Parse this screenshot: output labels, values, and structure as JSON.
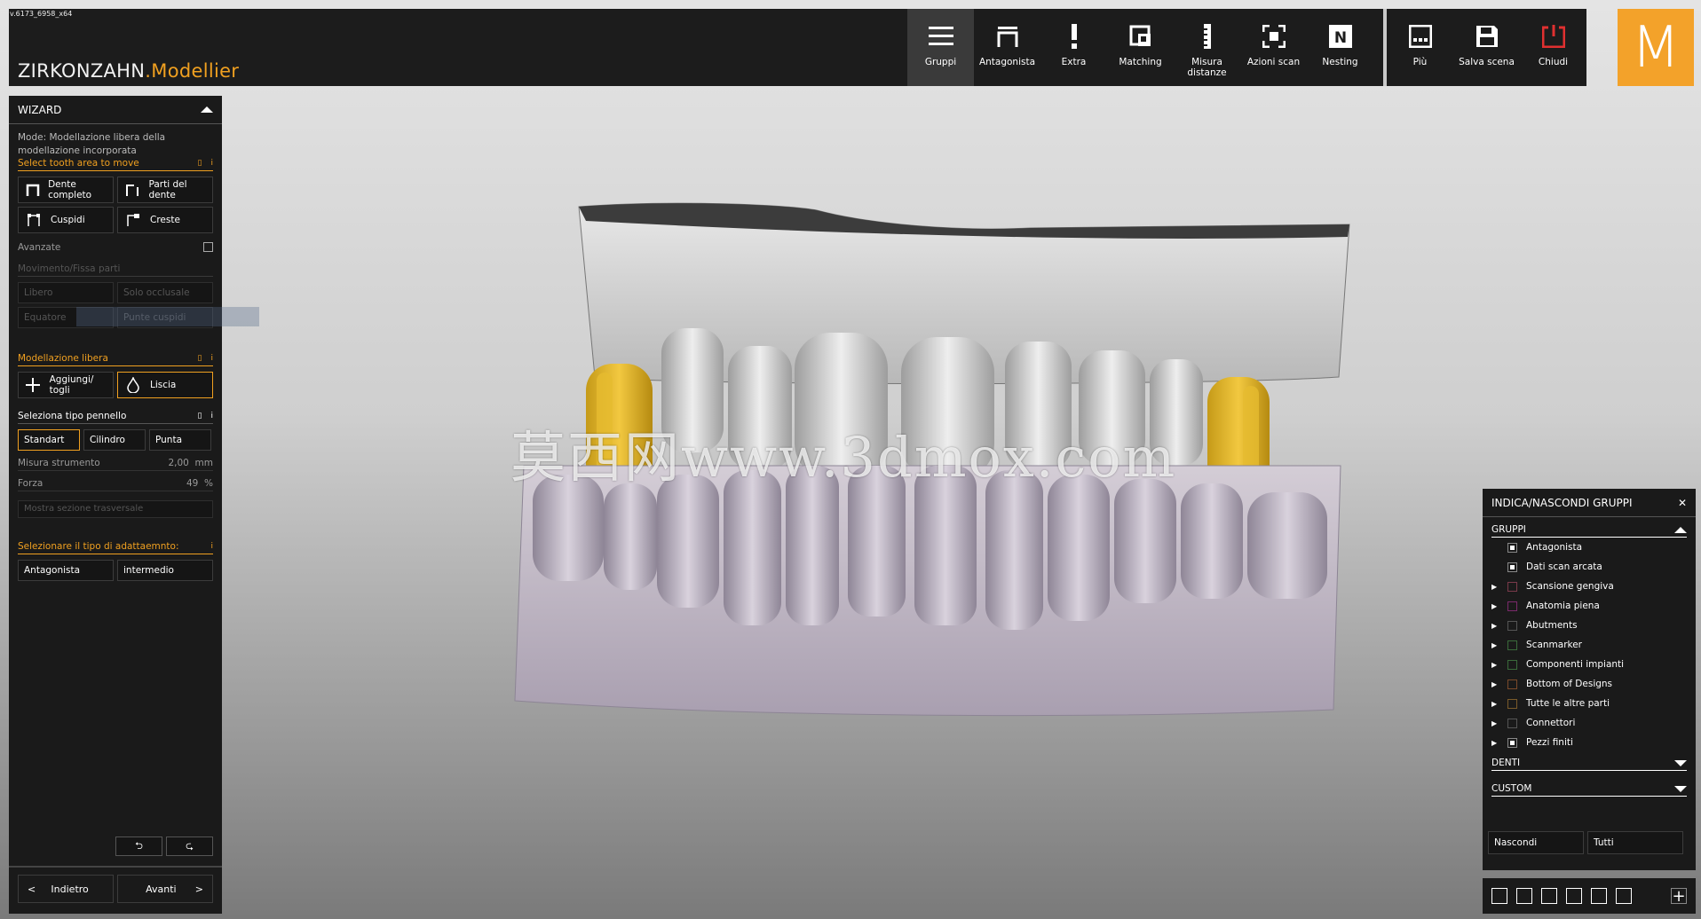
{
  "version": "v.6173_6958_x64",
  "brand": {
    "name": "ZIRKONZAHN",
    "sub": ".Modellier"
  },
  "toolbar": {
    "tools": [
      {
        "label": "Gruppi",
        "icon": "menu-icon"
      },
      {
        "label": "Antagonista",
        "icon": "antagonist-icon"
      },
      {
        "label": "Extra",
        "icon": "exclamation-icon"
      },
      {
        "label": "Matching",
        "icon": "matching-icon"
      },
      {
        "label": "Misura distanze",
        "icon": "ruler-icon"
      },
      {
        "label": "Azioni scan",
        "icon": "scan-icon"
      },
      {
        "label": "Nesting",
        "icon": "nesting-icon"
      }
    ],
    "right_tools": [
      {
        "label": "Più",
        "icon": "more-icon"
      },
      {
        "label": "Salva scena",
        "icon": "save-icon"
      },
      {
        "label": "Chiudi",
        "icon": "power-icon"
      }
    ],
    "logo_letter": "M"
  },
  "wizard": {
    "title": "WIZARD",
    "mode": "Mode: Modellazione libera della modellazione incorporata",
    "select_area_title": "Select tooth area to move",
    "area_buttons": [
      "Dente completo",
      "Parti del dente",
      "Cuspidi",
      "Creste"
    ],
    "advanced_label": "Avanzate",
    "movement_label": "Movimento/Fissa parti",
    "movement_buttons": [
      "Libero",
      "Solo occlusale",
      "Equatore",
      "Punte cuspidi"
    ],
    "free_modeling_title": "Modellazione libera",
    "free_buttons": [
      "Aggiungi/ togli",
      "Liscia"
    ],
    "brush_title": "Seleziona tipo pennello",
    "brush_buttons": [
      "Standart",
      "Cilindro",
      "Punta"
    ],
    "tool_size_label": "Misura strumento",
    "tool_size_value": "2,00",
    "tool_size_unit": "mm",
    "force_label": "Forza",
    "force_value": "49",
    "force_unit": "%",
    "cross_section_label": "Mostra sezione trasversale",
    "adapt_title": "Selezionare il tipo di adattaemnto:",
    "adapt_buttons": [
      "Antagonista",
      "intermedio"
    ],
    "back_label": "Indietro",
    "next_label": "Avanti"
  },
  "groups_panel": {
    "title": "INDICA/NASCONDI GRUPPI",
    "groups_label": "GRUPPI",
    "items": [
      {
        "label": "Antagonista",
        "arrow": false,
        "checked": true,
        "color": "#888888"
      },
      {
        "label": "Dati scan arcata",
        "arrow": false,
        "checked": true,
        "color": "#888888"
      },
      {
        "label": "Scansione gengiva",
        "arrow": true,
        "checked": false,
        "color": "#7a3a4a"
      },
      {
        "label": "Anatomia piena",
        "arrow": true,
        "checked": false,
        "color": "#7a2a6a"
      },
      {
        "label": "Abutments",
        "arrow": true,
        "checked": false,
        "color": "#555555"
      },
      {
        "label": "Scanmarker",
        "arrow": true,
        "checked": false,
        "color": "#3a6a3a"
      },
      {
        "label": "Componenti impianti",
        "arrow": true,
        "checked": false,
        "color": "#3a6a3a"
      },
      {
        "label": "Bottom of Designs",
        "arrow": true,
        "checked": false,
        "color": "#7a4a2a"
      },
      {
        "label": "Tutte le altre parti",
        "arrow": true,
        "checked": false,
        "color": "#7a5a2a"
      },
      {
        "label": "Connettori",
        "arrow": true,
        "checked": false,
        "color": "#555555"
      },
      {
        "label": "Pezzi finiti",
        "arrow": true,
        "checked": true,
        "color": "#888888"
      }
    ],
    "teeth_label": "DENTI",
    "custom_label": "CUSTOM",
    "hide_label": "Nascondi",
    "all_label": "Tutti"
  },
  "watermark": "莫西网www.3dmox.com",
  "colors": {
    "accent": "#f0a020",
    "logo_bg": "#f3a22a",
    "panel": "#1a1a1a",
    "gold_tooth": "#e2b52a",
    "gum": "#b8b0bc"
  }
}
